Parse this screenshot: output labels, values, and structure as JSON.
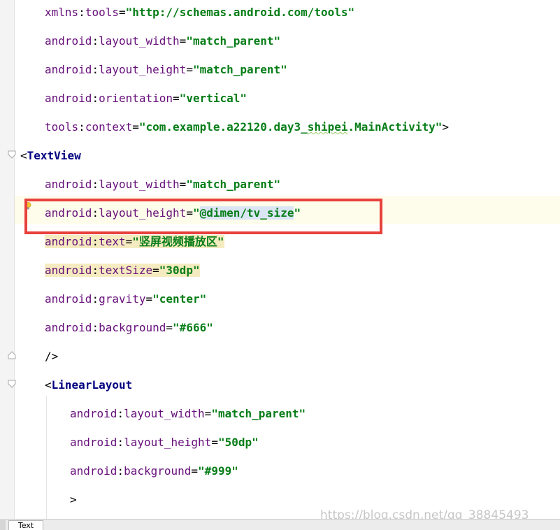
{
  "code_lines": [
    {
      "ns": "xmlns",
      "attr": "tools",
      "value": "\"http://schemas.android.com/tools\""
    },
    {
      "ns": "android",
      "attr": "layout_width",
      "value": "\"match_parent\""
    },
    {
      "ns": "android",
      "attr": "layout_height",
      "value": "\"match_parent\""
    },
    {
      "ns": "android",
      "attr": "orientation",
      "value": "\"vertical\""
    },
    {
      "ns": "tools",
      "attr": "context",
      "value_pre": "\"com.example.a22120.day3_",
      "value_squiggle": "shipei",
      "value_post": ".MainActivity\"",
      "close": ">"
    },
    {
      "tag": "TextView"
    },
    {
      "ns": "android",
      "attr": "layout_width",
      "value": "\"match_parent\""
    },
    {
      "ns": "android",
      "attr": "layout_height",
      "quote": "\"",
      "value_hl": "@dimen/tv_size",
      "quote_end": "\""
    },
    {
      "ns": "android",
      "attr": "text",
      "value": "\"竖屏视频播放区\""
    },
    {
      "ns": "android",
      "attr": "textSize",
      "value": "\"30dp\""
    },
    {
      "ns": "android",
      "attr": "gravity",
      "value": "\"center\""
    },
    {
      "ns": "android",
      "attr": "background",
      "value": "\"#666\""
    },
    {
      "close": "/>"
    },
    {
      "tag": "LinearLayout"
    },
    {
      "ns": "android",
      "attr": "layout_width",
      "value": "\"match_parent\""
    },
    {
      "ns": "android",
      "attr": "layout_height",
      "value": "\"50dp\""
    },
    {
      "ns": "android",
      "attr": "background",
      "value": "\"#999\""
    },
    {
      "close": ">"
    }
  ],
  "bottom_tab": {
    "label": "Text"
  },
  "watermark": "https://blog.csdn.net/qq_38845493",
  "icons": {
    "bulb": "lightbulb-icon",
    "fold": "fold-marker-icon"
  },
  "colors": {
    "highlight_box": "#e8413c",
    "caret_line": "#fefcea",
    "attr_ns": "#660e7a",
    "string_value": "#067d17"
  }
}
